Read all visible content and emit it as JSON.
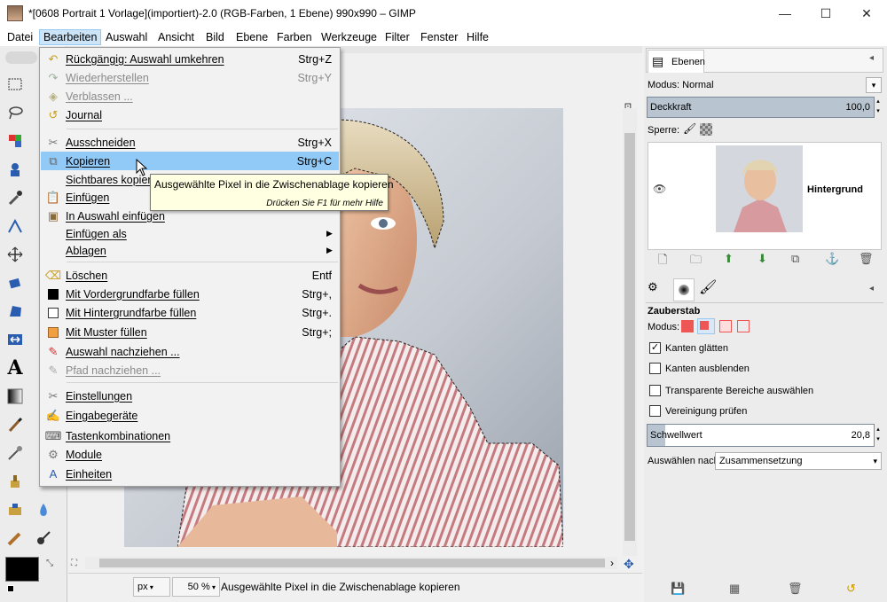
{
  "window": {
    "title": "*[0608 Portrait 1 Vorlage](importiert)-2.0 (RGB-Farben, 1 Ebene) 990x990 – GIMP",
    "minimize": "—",
    "maximize": "☐",
    "close": "✕"
  },
  "menubar": {
    "items": [
      "Datei",
      "Bearbeiten",
      "Auswahl",
      "Ansicht",
      "Bild",
      "Ebene",
      "Farben",
      "Werkzeuge",
      "Filter",
      "Fenster",
      "Hilfe"
    ],
    "active": "Bearbeiten"
  },
  "edit_menu": {
    "items": [
      {
        "label": "Rückgängig: Auswahl umkehren",
        "shortcut": "Strg+Z",
        "icon": "undo-icon",
        "disabled": false
      },
      {
        "label": "Wiederherstellen",
        "shortcut": "Strg+Y",
        "icon": "redo-icon",
        "disabled": true
      },
      {
        "label": "Verblassen ...",
        "shortcut": "",
        "icon": "fade-icon",
        "disabled": true
      },
      {
        "label": "Journal",
        "shortcut": "",
        "icon": "journal-icon",
        "disabled": false
      },
      {
        "label": "Ausschneiden",
        "shortcut": "Strg+X",
        "icon": "cut-icon",
        "disabled": false
      },
      {
        "label": "Kopieren",
        "shortcut": "Strg+C",
        "icon": "copy-icon",
        "disabled": false,
        "highlighted": true
      },
      {
        "label": "Sichtbares kopieren",
        "shortcut": "",
        "icon": "",
        "disabled": false
      },
      {
        "label": "Einfügen",
        "shortcut": "",
        "icon": "paste-icon",
        "disabled": false
      },
      {
        "label": "In Auswahl einfügen",
        "shortcut": "",
        "icon": "paste-into-icon",
        "disabled": false
      },
      {
        "label": "Einfügen als",
        "shortcut": "",
        "icon": "",
        "disabled": false,
        "submenu": true
      },
      {
        "label": "Ablagen",
        "shortcut": "",
        "icon": "",
        "disabled": false,
        "submenu": true
      },
      {
        "label": "Löschen",
        "shortcut": "Entf",
        "icon": "clear-icon",
        "disabled": false
      },
      {
        "label": "Mit Vordergrundfarbe füllen",
        "shortcut": "Strg+,",
        "icon": "fg-fill-icon",
        "disabled": false
      },
      {
        "label": "Mit Hintergrundfarbe füllen",
        "shortcut": "Strg+.",
        "icon": "bg-fill-icon",
        "disabled": false
      },
      {
        "label": "Mit Muster füllen",
        "shortcut": "Strg+;",
        "icon": "pattern-fill-icon",
        "disabled": false
      },
      {
        "label": "Auswahl nachziehen ...",
        "shortcut": "",
        "icon": "stroke-selection-icon",
        "disabled": false
      },
      {
        "label": "Pfad nachziehen ...",
        "shortcut": "",
        "icon": "stroke-path-icon",
        "disabled": true
      },
      {
        "label": "Einstellungen",
        "shortcut": "",
        "icon": "preferences-icon",
        "disabled": false
      },
      {
        "label": "Eingabegeräte",
        "shortcut": "",
        "icon": "input-devices-icon",
        "disabled": false
      },
      {
        "label": "Tastenkombinationen",
        "shortcut": "",
        "icon": "keyboard-shortcuts-icon",
        "disabled": false
      },
      {
        "label": "Module",
        "shortcut": "",
        "icon": "modules-icon",
        "disabled": false
      },
      {
        "label": "Einheiten",
        "shortcut": "",
        "icon": "units-icon",
        "disabled": false
      }
    ]
  },
  "tooltip": {
    "text": "Ausgewählte Pixel in die Zwischenablage kopieren",
    "hint": "Drücken Sie F1 für mehr Hilfe"
  },
  "statusbar": {
    "unit": "px",
    "zoom": "50 %",
    "message": "Ausgewählte Pixel in die Zwischenablage kopieren"
  },
  "layers_panel": {
    "tab_label": "Ebenen",
    "mode_label": "Modus: Normal",
    "opacity_label": "Deckkraft",
    "opacity_value": "100,0",
    "lock_label": "Sperre:",
    "layer_name": "Hintergrund"
  },
  "tool_options": {
    "tool_name": "Zauberstab",
    "mode_label": "Modus:",
    "options": [
      {
        "label": "Kanten glätten",
        "checked": true
      },
      {
        "label": "Kanten ausblenden",
        "checked": false
      },
      {
        "label": "Transparente Bereiche auswählen",
        "checked": false
      },
      {
        "label": "Vereinigung prüfen",
        "checked": false
      }
    ],
    "threshold_label": "Schwellwert",
    "threshold_value": "20,8",
    "select_by_label": "Auswählen nach:",
    "select_by_value": "Zusammensetzung"
  }
}
